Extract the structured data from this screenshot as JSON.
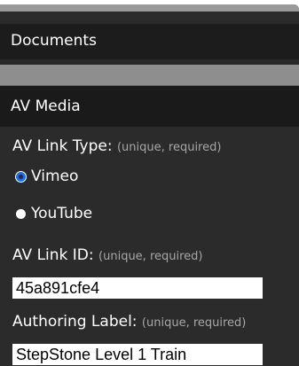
{
  "sections": {
    "documents": {
      "label": "Documents"
    },
    "av_media": {
      "label": "AV Media"
    }
  },
  "form": {
    "link_type": {
      "label": "AV Link Type:",
      "hint": "(unique, required)",
      "options": [
        {
          "label": "Vimeo",
          "selected": true
        },
        {
          "label": "YouTube",
          "selected": false
        }
      ]
    },
    "link_id": {
      "label": "AV Link ID:",
      "hint": "(unique, required)",
      "value": "45a891cfe4"
    },
    "authoring_label": {
      "label": "Authoring Label:",
      "hint": "(unique, required)",
      "value": "StepStone Level 1 Train"
    }
  },
  "colors": {
    "panel_bg": "#2b2b2b",
    "header_bg": "#1c1c1c",
    "strip_bg": "#8e8e8e",
    "hint_text": "#a7a7a7",
    "radio_selected": "#1d6cf0"
  }
}
